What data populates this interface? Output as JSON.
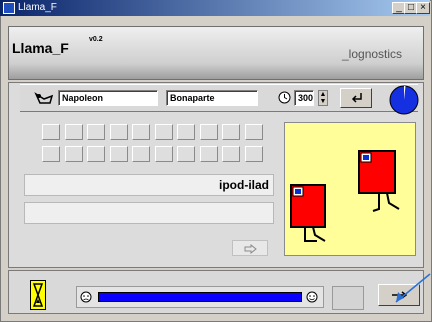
{
  "window": {
    "title": "Llama_F"
  },
  "header": {
    "app_name": "Llama_F",
    "version": "v0.2",
    "brand": "_lognostics"
  },
  "inputs": {
    "first_name": "Napoleon",
    "last_name": "Bonaparte",
    "time_value": "300"
  },
  "display": {
    "word": "ipod-ilad",
    "answer": ""
  },
  "progress": {
    "fill": 1.0
  },
  "colors": {
    "progress_bar": "#0a00ff",
    "timer_pie": "#1530e0",
    "picture_bg": "#fffe99",
    "llama_body": "#ff0000",
    "hourglass_bg": "#ffff00"
  }
}
